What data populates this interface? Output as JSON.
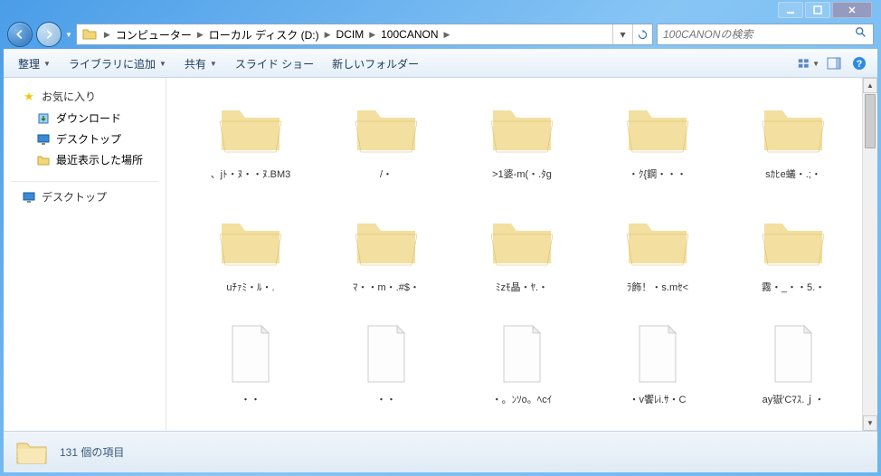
{
  "breadcrumbs": [
    "コンピューター",
    "ローカル ディスク (D:)",
    "DCIM",
    "100CANON"
  ],
  "search_placeholder": "100CANONの検索",
  "toolbar": {
    "organize": "整理",
    "add_library": "ライブラリに追加",
    "share": "共有",
    "slideshow": "スライド ショー",
    "new_folder": "新しいフォルダー"
  },
  "sidebar": {
    "favorites": "お気に入り",
    "downloads": "ダウンロード",
    "desktop_fav": "デスクトップ",
    "recent": "最近表示した場所",
    "desktop": "デスクトップ"
  },
  "items": [
    {
      "name": "、jﾄ・ﾇ・・ﾇ.BM3",
      "type": "folder"
    },
    {
      "name": "/・",
      "type": "folder"
    },
    {
      "name": ">1婆-m(・.ﾀg",
      "type": "folder"
    },
    {
      "name": "・ｸ{鋼・・・",
      "type": "folder"
    },
    {
      "name": "sｶﾋe蟻・.;・",
      "type": "folder"
    },
    {
      "name": "uﾁｧﾐ・ﾙ・.",
      "type": "folder"
    },
    {
      "name": "ﾏ・・m・.#$・",
      "type": "folder"
    },
    {
      "name": "ﾐzﾓ晶・ﾔ.・",
      "type": "folder"
    },
    {
      "name": "ﾗ飾！・s.mｾ<",
      "type": "folder"
    },
    {
      "name": "霧・_・・5.・",
      "type": "folder"
    },
    {
      "name": "・・",
      "type": "file"
    },
    {
      "name": "・・",
      "type": "file"
    },
    {
      "name": "・。ﾝｿo。ﾍcｲ",
      "type": "file"
    },
    {
      "name": "・v饗ﾚi.ｻ・C",
      "type": "file"
    },
    {
      "name": "ay嶽'Cﾏｽ.ｊ・",
      "type": "file"
    }
  ],
  "status": "131 個の項目"
}
